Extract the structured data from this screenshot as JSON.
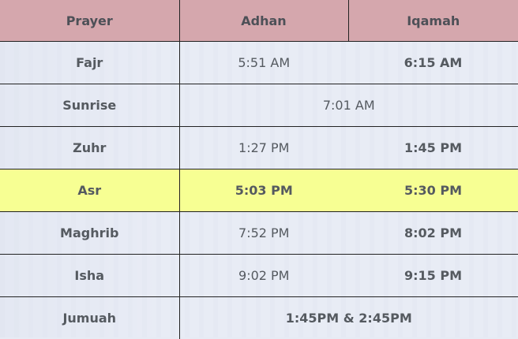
{
  "table": {
    "headers": {
      "prayer": "Prayer",
      "adhan": "Adhan",
      "iqamah": "Iqamah"
    },
    "rows": [
      {
        "name": "Fajr",
        "adhan": "5:51 AM",
        "iqamah": "6:15 AM"
      },
      {
        "name": "Sunrise",
        "time": "7:01 AM"
      },
      {
        "name": "Zuhr",
        "adhan": "1:27 PM",
        "iqamah": "1:45 PM"
      },
      {
        "name": "Asr",
        "adhan": "5:03 PM",
        "iqamah": "5:30 PM"
      },
      {
        "name": "Maghrib",
        "adhan": "7:52 PM",
        "iqamah": "8:02 PM"
      },
      {
        "name": "Isha",
        "adhan": "9:02 PM",
        "iqamah": "9:15 PM"
      },
      {
        "name": "Jumuah",
        "time": "1:45PM & 2:45PM"
      }
    ],
    "highlight_row": "Asr",
    "colors": {
      "header_bg": "#d5a7ad",
      "highlight_bg": "#f7ff93",
      "row_bg": "#e8ecf6",
      "text": "#555a60"
    }
  }
}
